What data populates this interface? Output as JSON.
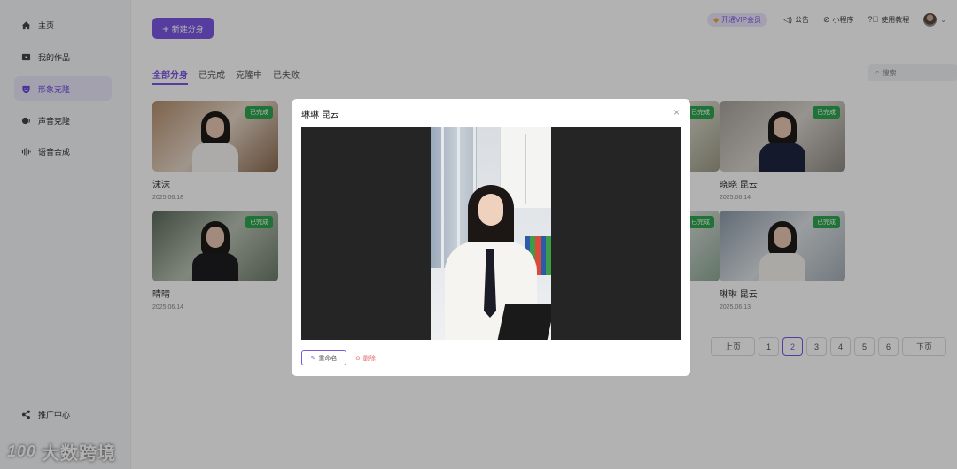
{
  "sidebar": {
    "items": [
      {
        "label": "主页",
        "icon": "home-icon"
      },
      {
        "label": "我的作品",
        "icon": "video-icon"
      },
      {
        "label": "形象克隆",
        "icon": "face-icon",
        "active": true
      },
      {
        "label": "声音克隆",
        "icon": "voice-icon"
      },
      {
        "label": "语音合成",
        "icon": "waveform-icon"
      }
    ],
    "promo_label": "推广中心"
  },
  "watermark": {
    "logo": "100",
    "text": "大数跨境"
  },
  "header": {
    "new_button_label": "新建分身",
    "vip_label": "开通VIP会员",
    "notice_label": "公告",
    "miniprogram_label": "小程序",
    "tutorial_label": "使用教程"
  },
  "tabs": [
    {
      "label": "全部分身",
      "active": true
    },
    {
      "label": "已完成"
    },
    {
      "label": "克隆中"
    },
    {
      "label": "已失败"
    }
  ],
  "search": {
    "placeholder": "搜索"
  },
  "cards": [
    {
      "name": "沫沫",
      "date": "2025.06.18",
      "status": "已完成"
    },
    {
      "name": "晓晓 昆云",
      "date": "2025.06.14",
      "status": "已完成"
    },
    {
      "name": "晴晴",
      "date": "2025.06.14",
      "status": "已完成"
    },
    {
      "name": "琳琳 昆云",
      "date": "2025.06.13",
      "status": "已完成"
    },
    {
      "status": "已完成"
    },
    {
      "status": "已完成"
    }
  ],
  "pagination": {
    "prev_label": "上页",
    "next_label": "下页",
    "pages": [
      "1",
      "2",
      "3",
      "4",
      "5",
      "6"
    ],
    "current": "2"
  },
  "modal": {
    "title": "琳琳 昆云",
    "close_glyph": "×",
    "rename_label": "重命名",
    "delete_label": "删除"
  },
  "colors": {
    "accent": "#7b57e4",
    "success": "#2fa54f",
    "danger": "#e0555d"
  }
}
